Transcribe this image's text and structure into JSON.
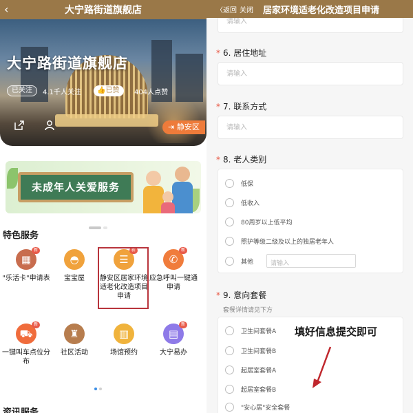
{
  "left": {
    "header": {
      "back_icon": "chevron-left-icon",
      "title": "大宁路街道旗舰店"
    },
    "hero": {
      "store_name": "大宁路街道旗舰店",
      "follow_label": "已关注",
      "followers": "4.1千人关注",
      "liked_label": "已赞",
      "likes": "404人点赞",
      "district_label": "静安区",
      "share_icon": "share-icon",
      "user_icon": "user-icon"
    },
    "banner": {
      "text": "未成年人关爱服务"
    },
    "featured_title": "特色服务",
    "services": [
      {
        "label": "\"乐活卡\"申请表",
        "icon": "card-icon",
        "color": "#c86d4e",
        "badge": "新"
      },
      {
        "label": "宝宝屋",
        "icon": "baby-icon",
        "color": "#f0a23c",
        "badge": ""
      },
      {
        "label": "静安区居家环境适老化改造项目申请",
        "icon": "document-icon",
        "color": "#f0a23c",
        "badge": "新"
      },
      {
        "label": "应急呼叫一键通申请",
        "icon": "phone-icon",
        "color": "#f07c3c",
        "badge": "新"
      },
      {
        "label": "一键叫车点位分布",
        "icon": "car-icon",
        "color": "#f06c3c",
        "badge": "新"
      },
      {
        "label": "社区活动",
        "icon": "cup-icon",
        "color": "#b77d4e",
        "badge": ""
      },
      {
        "label": "场馆预约",
        "icon": "building-icon",
        "color": "#f0b33c",
        "badge": ""
      },
      {
        "label": "大宁易办",
        "icon": "tablet-icon",
        "color": "#8e7ae8",
        "badge": "新"
      }
    ],
    "info_title": "资讯服务"
  },
  "right": {
    "header": {
      "back_label": "〈返回",
      "close_label": "关闭",
      "title": "居家环境适老化改造项目申请"
    },
    "top_input_placeholder": "请输入",
    "q6": {
      "label": "6. 居住地址",
      "placeholder": "请输入"
    },
    "q7": {
      "label": "7. 联系方式",
      "placeholder": "请输入"
    },
    "q8": {
      "label": "8. 老人类别",
      "options": [
        "低保",
        "低收入",
        "80周岁以上低平均",
        "照护等级二级及以上的独居老年人",
        "其他"
      ],
      "other_placeholder": "请输入"
    },
    "q9": {
      "label": "9. 意向套餐",
      "hint": "套餐详情请见下方",
      "options": [
        "卫生间套餐A",
        "卫生间套餐B",
        "起居室套餐A",
        "起居室套餐B",
        "\"安心居\"安全套餐"
      ]
    },
    "annotation": "填好信息提交即可",
    "required_mark": "*"
  }
}
